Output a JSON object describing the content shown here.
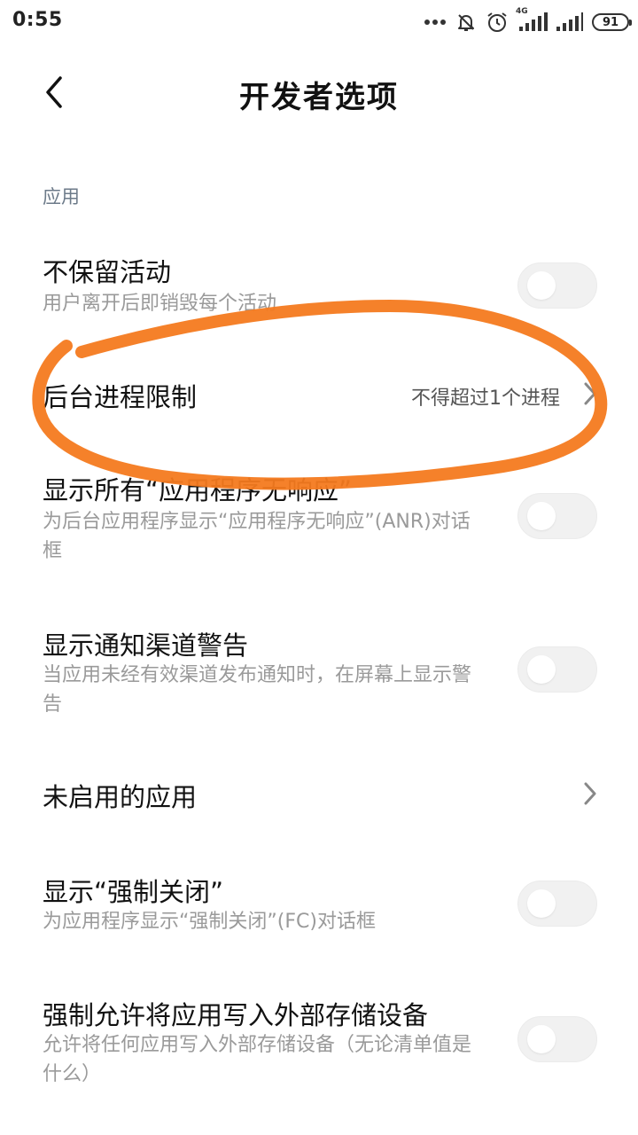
{
  "status_bar": {
    "time": "0:55",
    "network_label": "4G",
    "battery": "91"
  },
  "header": {
    "title": "开发者选项"
  },
  "section": {
    "label": "应用"
  },
  "rows": [
    {
      "title": "不保留活动",
      "subtitle": "用户离开后即销毁每个活动",
      "control": "toggle",
      "checked": false
    },
    {
      "title": "后台进程限制",
      "value": "不得超过1个进程",
      "control": "chevron"
    },
    {
      "title": "显示所有“应用程序无响应”",
      "subtitle": "为后台应用程序显示“应用程序无响应”(ANR)对话框",
      "control": "toggle",
      "checked": false
    },
    {
      "title": "显示通知渠道警告",
      "subtitle": "当应用未经有效渠道发布通知时，在屏幕上显示警告",
      "control": "toggle",
      "checked": false
    },
    {
      "title": "未启用的应用",
      "control": "chevron"
    },
    {
      "title": "显示“强制关闭”",
      "subtitle": "为应用程序显示“强制关闭”(FC)对话框",
      "control": "toggle",
      "checked": false
    },
    {
      "title": "强制允许将应用写入外部存储设备",
      "subtitle": "允许将任何应用写入外部存储设备（无论清单值是什么）",
      "control": "toggle",
      "checked": false
    }
  ],
  "colors": {
    "annotation": "#f47a1f",
    "section_label": "#6c7a89",
    "subtitle": "#9a9a9a",
    "toggle_off": "#f1f1f1"
  }
}
